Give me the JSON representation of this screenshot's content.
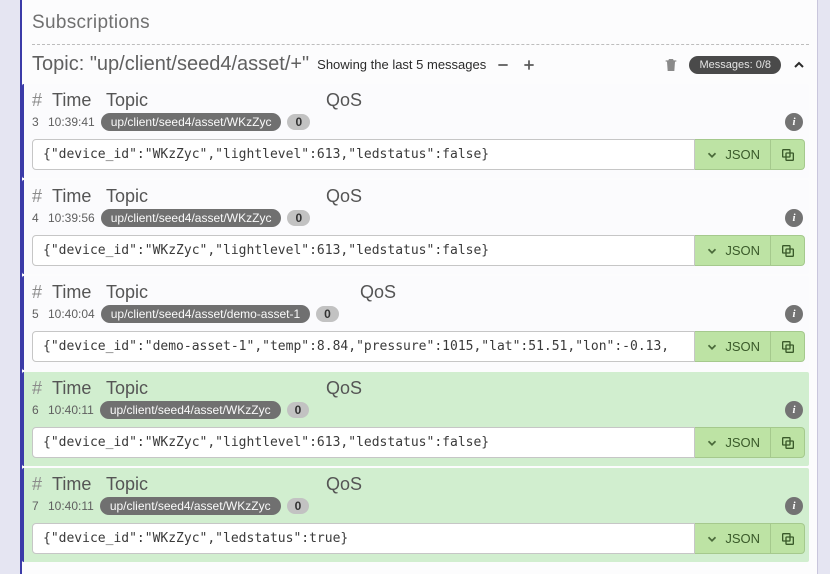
{
  "section_title": "Subscriptions",
  "topic_prefix": "Topic: ",
  "topic_value": "\"up/client/seed4/asset/+\"",
  "showing_text": "Showing the last 5 messages",
  "messages_badge": "Messages: 0/8",
  "columns": {
    "hash": "#",
    "time": "Time",
    "topic": "Topic",
    "qos": "QoS"
  },
  "json_label": "JSON",
  "messages": [
    {
      "idx": "3",
      "time": "10:39:41",
      "topic": "up/client/seed4/asset/WKzZyc",
      "qos": "0",
      "payload": "{\"device_id\":\"WKzZyc\",\"lightlevel\":613,\"ledstatus\":false}",
      "highlight": false,
      "qosOffset": 294
    },
    {
      "idx": "4",
      "time": "10:39:56",
      "topic": "up/client/seed4/asset/WKzZyc",
      "qos": "0",
      "payload": "{\"device_id\":\"WKzZyc\",\"lightlevel\":613,\"ledstatus\":false}",
      "highlight": false,
      "qosOffset": 294
    },
    {
      "idx": "5",
      "time": "10:40:04",
      "topic": "up/client/seed4/asset/demo-asset-1",
      "qos": "0",
      "payload": "{\"device_id\":\"demo-asset-1\",\"temp\":8.84,\"pressure\":1015,\"lat\":51.51,\"lon\":-0.13,",
      "highlight": false,
      "qosOffset": 328
    },
    {
      "idx": "6",
      "time": "10:40:11",
      "topic": "up/client/seed4/asset/WKzZyc",
      "qos": "0",
      "payload": "{\"device_id\":\"WKzZyc\",\"lightlevel\":613,\"ledstatus\":false}",
      "highlight": true,
      "qosOffset": 294
    },
    {
      "idx": "7",
      "time": "10:40:11",
      "topic": "up/client/seed4/asset/WKzZyc",
      "qos": "0",
      "payload": "{\"device_id\":\"WKzZyc\",\"ledstatus\":true}",
      "highlight": true,
      "qosOffset": 294
    }
  ]
}
